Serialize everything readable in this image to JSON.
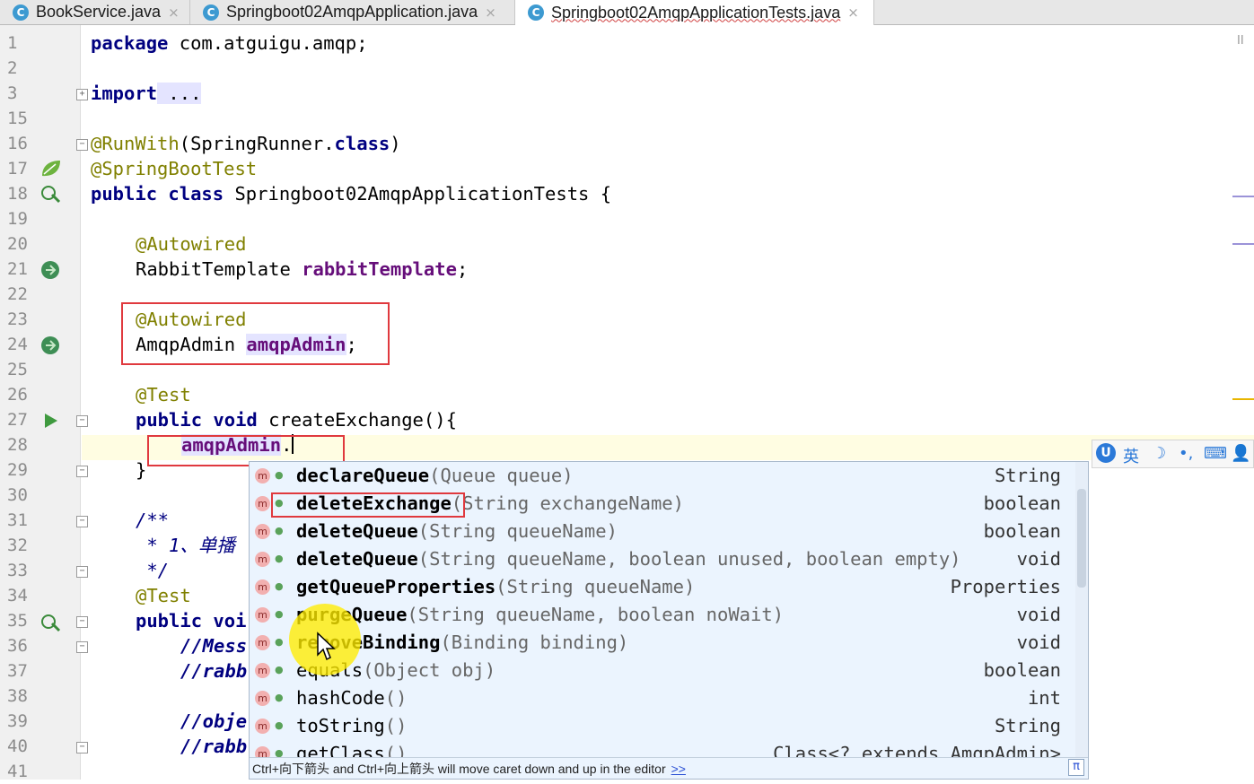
{
  "tabs": [
    {
      "icon": "C",
      "label": "BookService.java",
      "close": "×"
    },
    {
      "icon": "C",
      "label": "Springboot02AmqpApplication.java",
      "close": "×"
    },
    {
      "icon": "C",
      "label": "Springboot02AmqpApplicationTests.java",
      "close": "×"
    }
  ],
  "line_numbers": [
    "1",
    "2",
    "3",
    "15",
    "16",
    "17",
    "18",
    "19",
    "20",
    "21",
    "22",
    "23",
    "24",
    "25",
    "26",
    "27",
    "28",
    "29",
    "30",
    "31",
    "32",
    "33",
    "34",
    "35",
    "36",
    "37",
    "38",
    "39",
    "40",
    "41"
  ],
  "code": {
    "l1_kw": "package",
    "l1_rest": " com.atguigu.amqp;",
    "l3_kw": "import",
    "l3_rest": " ...",
    "l16_ann": "@RunWith",
    "l16_a": "(SpringRunner.",
    "l16_kw": "class",
    "l16_b": ")",
    "l17_ann": "@SpringBootTest",
    "l18_kw": "public class",
    "l18_rest": " Springboot02AmqpApplicationTests {",
    "l20_ann": "@Autowired",
    "l21_type": "RabbitTemplate ",
    "l21_fld": "rabbitTemplate",
    "l21_end": ";",
    "l23_ann": "@Autowired",
    "l24_type": "AmqpAdmin ",
    "l24_fld": "amqpAdmin",
    "l24_end": ";",
    "l26_ann": "@Test",
    "l27_kw": "public void",
    "l27_rest": " createExchange(){",
    "l28_fld": "amqpAdmin",
    "l28_rest": ".",
    "l29": "}",
    "l31": "/**",
    "l32": " * 1、单播",
    "l33": " */",
    "l34_ann": "@Test",
    "l35_kw": "public voi",
    "l36": "//Mess",
    "l37": "//rabb",
    "l39": "//obje",
    "l40": "//rabb"
  },
  "completion": {
    "items": [
      {
        "name": "declareQueue",
        "params": "(Queue queue)",
        "ret": "String",
        "bold": true
      },
      {
        "name": "deleteExchange",
        "params": "(String exchangeName)",
        "ret": "boolean",
        "bold": true
      },
      {
        "name": "deleteQueue",
        "params": "(String queueName)",
        "ret": "boolean",
        "bold": true
      },
      {
        "name": "deleteQueue",
        "params": "(String queueName, boolean unused, boolean empty)",
        "ret": "void",
        "bold": true
      },
      {
        "name": "getQueueProperties",
        "params": "(String queueName)",
        "ret": "Properties",
        "bold": true
      },
      {
        "name": "purgeQueue",
        "params": "(String queueName, boolean noWait)",
        "ret": "void",
        "bold": true
      },
      {
        "name": "removeBinding",
        "params": "(Binding binding)",
        "ret": "void",
        "bold": true
      },
      {
        "name": "equals",
        "params": "(Object obj)",
        "ret": "boolean",
        "bold": false
      },
      {
        "name": "hashCode",
        "params": "()",
        "ret": "int",
        "bold": false
      },
      {
        "name": "toString",
        "params": "()",
        "ret": "String",
        "bold": false
      },
      {
        "name": "getClass",
        "params": "()",
        "ret": "Class<? extends AmqpAdmin>",
        "bold": false
      }
    ],
    "method_icon": "m",
    "hint": "Ctrl+向下箭头 and Ctrl+向上箭头 will move caret down and up in the editor",
    "hint_link": ">>",
    "pi": "π"
  },
  "ime": {
    "logo": "U",
    "lang": "英",
    "moon": "☽",
    "dots": "•,",
    "kbd": "⌨",
    "user": "👤"
  },
  "colors": {
    "keyword": "#000080",
    "annotation": "#808000",
    "field": "#660e7a",
    "highlight_box": "#e0393e",
    "popup_bg": "#ebf4fe"
  }
}
